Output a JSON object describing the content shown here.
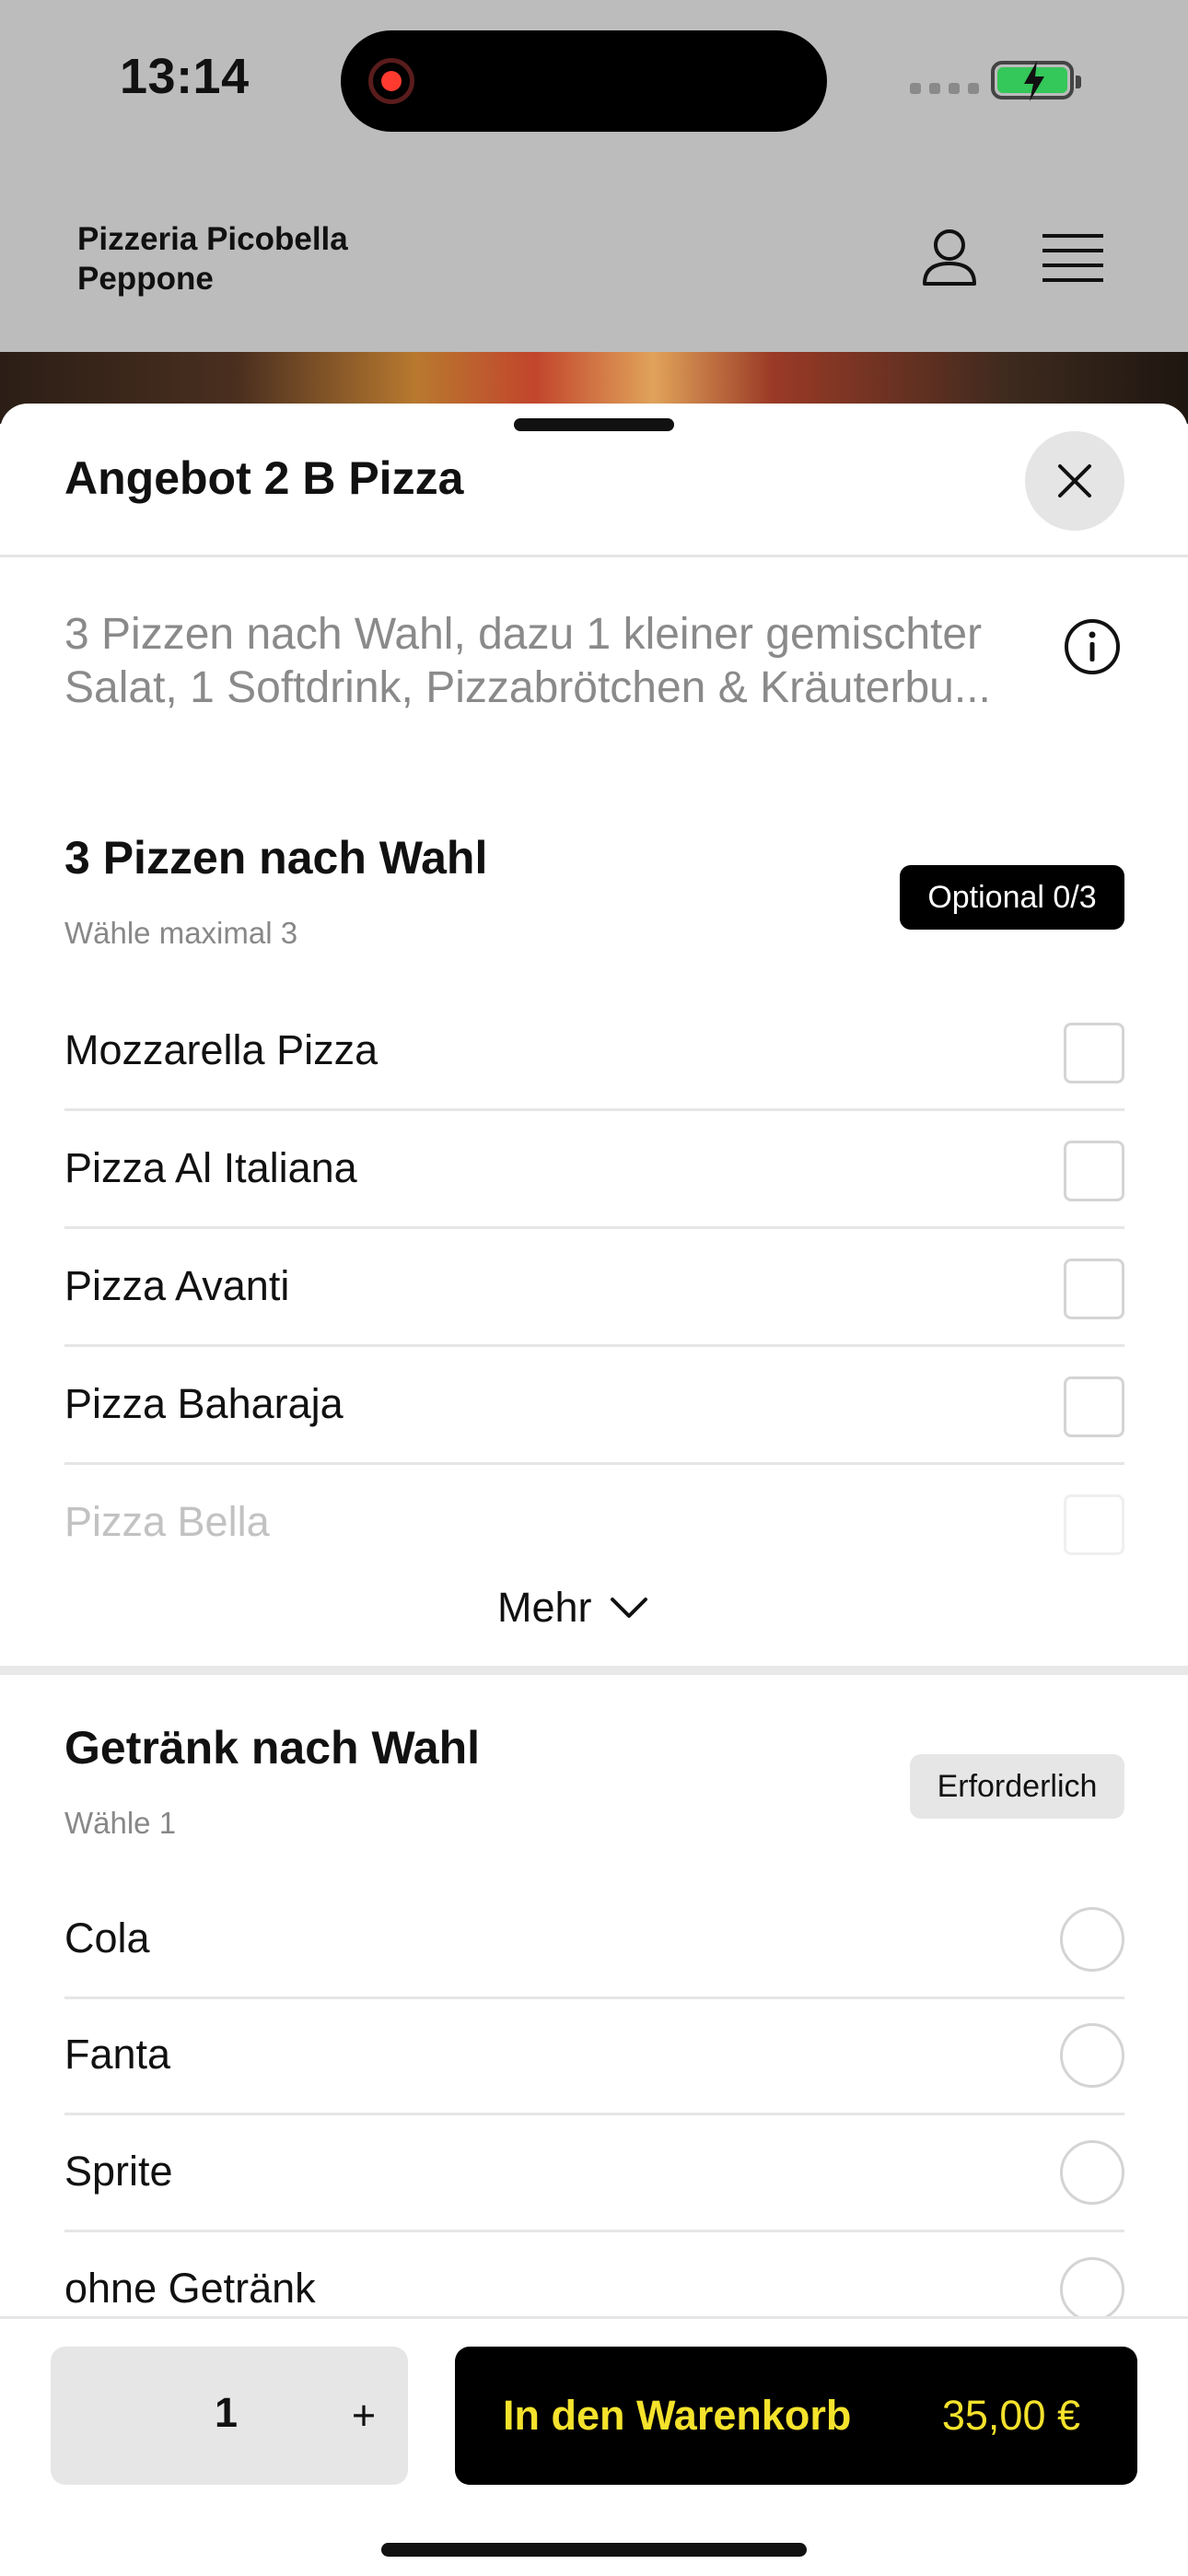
{
  "status_bar": {
    "time": "13:14",
    "icons": [
      "screen-recording-icon",
      "signal-icon",
      "battery-charging-icon"
    ],
    "battery_color": "#34c759"
  },
  "header": {
    "restaurant_name": "Pizzeria Picobella Peppone",
    "icons": [
      "user-icon",
      "menu-icon"
    ]
  },
  "sheet": {
    "title": "Angebot 2 B Pizza",
    "description": "3 Pizzen nach Wahl, dazu 1 kleiner gemischter Salat, 1 Softdrink, Pizzabrötchen & Kräuterbu..."
  },
  "sections": [
    {
      "title": "3 Pizzen nach Wahl",
      "subtitle": "Wähle maximal 3",
      "badge": "Optional 0/3",
      "options": [
        "Mozzarella Pizza",
        "Pizza Al Italiana",
        "Pizza Avanti",
        "Pizza Baharaja",
        "Pizza Bella"
      ],
      "more_label": "Mehr"
    },
    {
      "title": "Getränk nach Wahl",
      "subtitle": "Wähle 1",
      "badge": "Erforderlich",
      "options": [
        "Cola",
        "Fanta",
        "Sprite",
        "ohne Getränk"
      ]
    }
  ],
  "bottom_bar": {
    "quantity": "1",
    "plus": "+",
    "cart_label": "In den Warenkorb",
    "price": "35,00 €",
    "accent_color": "#f4e22c"
  }
}
